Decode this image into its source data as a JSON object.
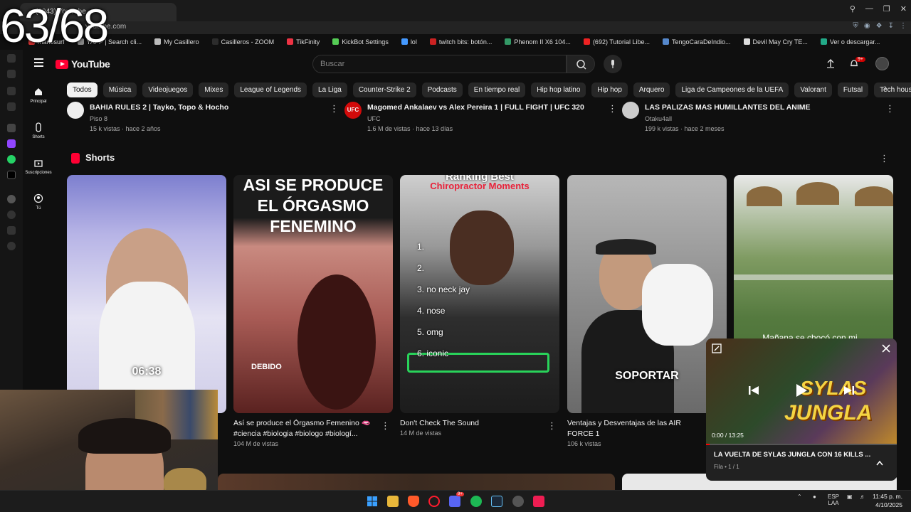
{
  "overlay": {
    "counter": "63/68"
  },
  "browser": {
    "tab_title": "(9943) YouTube",
    "url": "youtube.com",
    "bookmarks": [
      {
        "label": "manosurf",
        "color": "#d33"
      },
      {
        "label": "YAPP | Search cli...",
        "color": "#888"
      },
      {
        "label": "My Casillero",
        "color": "#bbb"
      },
      {
        "label": "Casilleros - ZOOM",
        "color": "#2c2c2c"
      },
      {
        "label": "TikFinity",
        "color": "#e34"
      },
      {
        "label": "KickBot Settings",
        "color": "#5c5"
      },
      {
        "label": "lol",
        "color": "#49f"
      },
      {
        "label": "twitch bits: botón...",
        "color": "#c22"
      },
      {
        "label": "Phenom II X6 104...",
        "color": "#396"
      },
      {
        "label": "(692) Tutorial Libe...",
        "color": "#e22"
      },
      {
        "label": "TengoCaraDeIndio...",
        "color": "#58c"
      },
      {
        "label": "Devil May Cry TE...",
        "color": "#ddd"
      },
      {
        "label": "Ver o descargar...",
        "color": "#2a8"
      }
    ]
  },
  "header": {
    "logo": "YouTube",
    "search_placeholder": "Buscar",
    "notifications_badge": "9+"
  },
  "chips": [
    "Todos",
    "Música",
    "Videojuegos",
    "Mixes",
    "League of Legends",
    "La Liga",
    "Counter-Strike 2",
    "Podcasts",
    "En tiempo real",
    "Hip hop latino",
    "Hip hop",
    "Arquero",
    "Liga de Campeones de la UEFA",
    "Valorant",
    "Futsal",
    "Tech hous"
  ],
  "guide": [
    {
      "label": "Principal",
      "icon": "home-icon"
    },
    {
      "label": "Shorts",
      "icon": "shorts-icon"
    },
    {
      "label": "Suscripciones",
      "icon": "subscriptions-icon"
    },
    {
      "label": "Tú",
      "icon": "you-icon"
    }
  ],
  "videos": [
    {
      "title": "BAHIA RULES 2 | Tayko, Topo & Hocho",
      "channel": "Piso 8",
      "meta": "15 k vistas · hace 2 años"
    },
    {
      "title": "Magomed Ankalaev vs Alex Pereira 1 | FULL FIGHT | UFC 320",
      "channel": "UFC",
      "meta": "1.6 M de vistas · hace 13 días"
    },
    {
      "title": "LAS PALIZAS MAS HUMILLANTES DEL ANIME",
      "channel": "Otaku4all",
      "meta": "199 k vistas · hace 2 meses"
    }
  ],
  "shorts": {
    "section_title": "Shorts",
    "items": [
      {
        "title": "",
        "views": "",
        "overlay": "06:38",
        "bg": "#8a86c9"
      },
      {
        "title": "Así se produce el Órgasmo Femenino 🫦 #ciencia #biologia #biologo #biologí...",
        "views": "104 M de vistas",
        "overlay_top": "ASI SE PRODUCE EL ÓRGASMO FENEMINO",
        "overlay": "DEBIDO",
        "bg": "#7a3a36"
      },
      {
        "title": "Don't Check The Sound",
        "views": "14 M de vistas",
        "overlay_top": "Ranking Best",
        "overlay_sub": "Chiropractor Moments",
        "list": [
          "1.",
          "2.",
          "3. no neck jay",
          "4. nose",
          "5. omg",
          "6. iconic"
        ],
        "bg": "#3c3c3c"
      },
      {
        "title": "Ventajas y Desventajas de las AIR FORCE 1",
        "views": "106 k vistas",
        "overlay": "SOPORTAR",
        "bg": "#9a9a9a"
      },
      {
        "title": "",
        "views": "",
        "overlay": "Mañana se chocó con mi...",
        "bg": "#5b7b4a"
      }
    ]
  },
  "mini_player": {
    "time": "0:00 / 13:25",
    "title": "LA VUELTA DE SYLAS JUNGLA CON 16 KILLS ...",
    "queue": "Fila • 1 / 1",
    "thumb_text_1": "SYLAS",
    "thumb_text_2": "JUNGLA",
    "progress": 0.02
  },
  "taskbar": {
    "lang": "ESP",
    "lang2": "LAA",
    "time": "11:45 p. m.",
    "date": "4/10/2025",
    "discord_badge": "9+"
  }
}
